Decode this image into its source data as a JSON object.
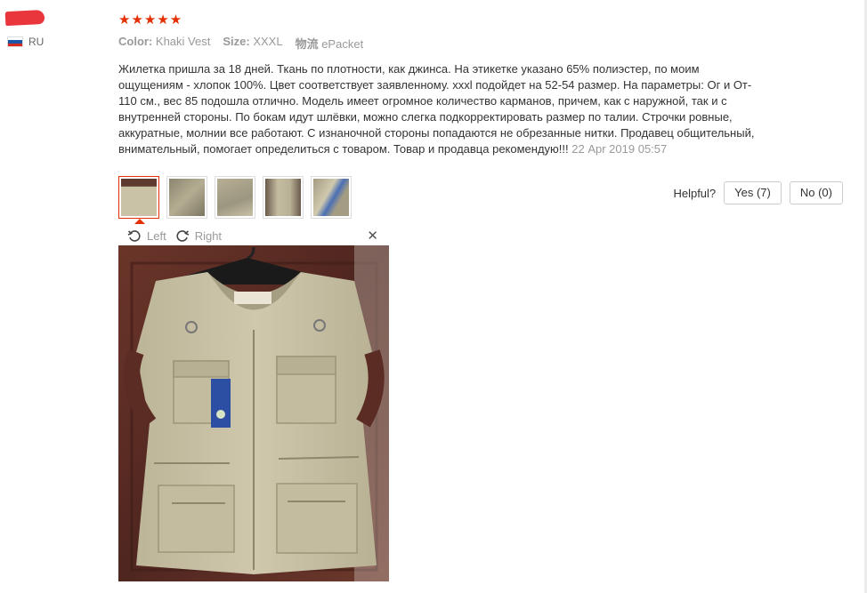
{
  "reviewer": {
    "country": "RU",
    "flag_colors": [
      "#ffffff",
      "#1c57a7",
      "#d52b1e"
    ]
  },
  "review": {
    "stars": "★★★★★",
    "rating": 5,
    "color_label": "Color:",
    "color_value": "Khaki Vest",
    "size_label": "Size:",
    "size_value": "XXXL",
    "shipping_label": "物流",
    "shipping_value": "ePacket",
    "text": "Жилетка пришла за 18 дней. Ткань по плотности, как джинса. На этикетке указано 65% полиэстер, по моим ощущениям - хлопок 100%. Цвет соответствует заявленному. xxxl подойдет на 52-54 размер. На параметры: Ог и От- 110 см., вес 85 подошла отлично. Модель имеет огромное количество карманов, причем, как с наружной, так и с внутренней стороны. По бокам идут шлёвки, можно слегка подкорректировать размер по талии. Строчки ровные, аккуратные, молнии все работают. С изнаночной стороны попадаются не обрезанные нитки. Продавец общительный, внимательный, помогает определиться с товаром. Товар и продавца рекомендую!!!",
    "date": "22 Apr 2019 05:57"
  },
  "thumbnails": [
    "thumb-1",
    "thumb-2",
    "thumb-3",
    "thumb-4",
    "thumb-5"
  ],
  "helpful": {
    "label": "Helpful?",
    "yes": "Yes (7)",
    "no": "No (0)"
  },
  "viewer": {
    "rotate_left": "Left",
    "rotate_right": "Right",
    "close": "✕"
  },
  "colors": {
    "star": "#e62e04",
    "accent": "#e62e04",
    "muted": "#999999",
    "vest": "#c8c0a3",
    "door": "#5e2d24"
  }
}
